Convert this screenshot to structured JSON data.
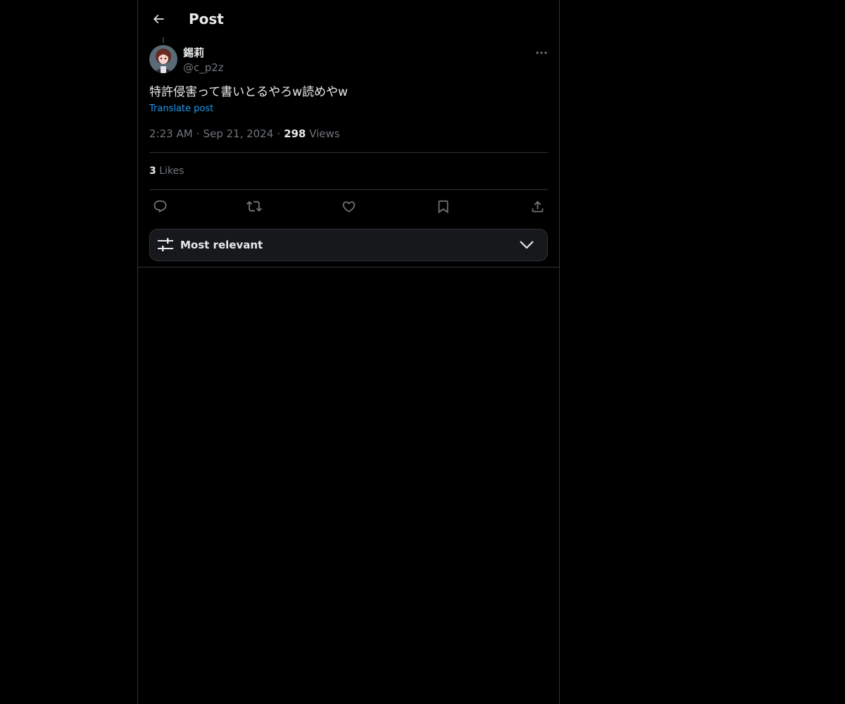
{
  "header": {
    "title": "Post"
  },
  "author": {
    "name": "錫莉",
    "handle": "@c_p2z"
  },
  "post": {
    "text": "特許侵害って書いとるやろw読めやw",
    "translate_label": "Translate post",
    "time": "2:23 AM",
    "date": "Sep 21, 2024",
    "views_count": "298",
    "views_label": "Views",
    "likes_count": "3",
    "likes_label": "Likes"
  },
  "actions": [
    {
      "icon": "reply-icon"
    },
    {
      "icon": "repost-icon"
    },
    {
      "icon": "like-icon"
    },
    {
      "icon": "bookmark-icon"
    },
    {
      "icon": "share-icon"
    }
  ],
  "sort": {
    "label": "Most relevant",
    "icon": "sliders-icon"
  },
  "colors": {
    "background": "#000000",
    "accent": "#1d9bf0",
    "muted": "#71767b",
    "text": "#e7e9ea",
    "border": "#2f3336"
  }
}
